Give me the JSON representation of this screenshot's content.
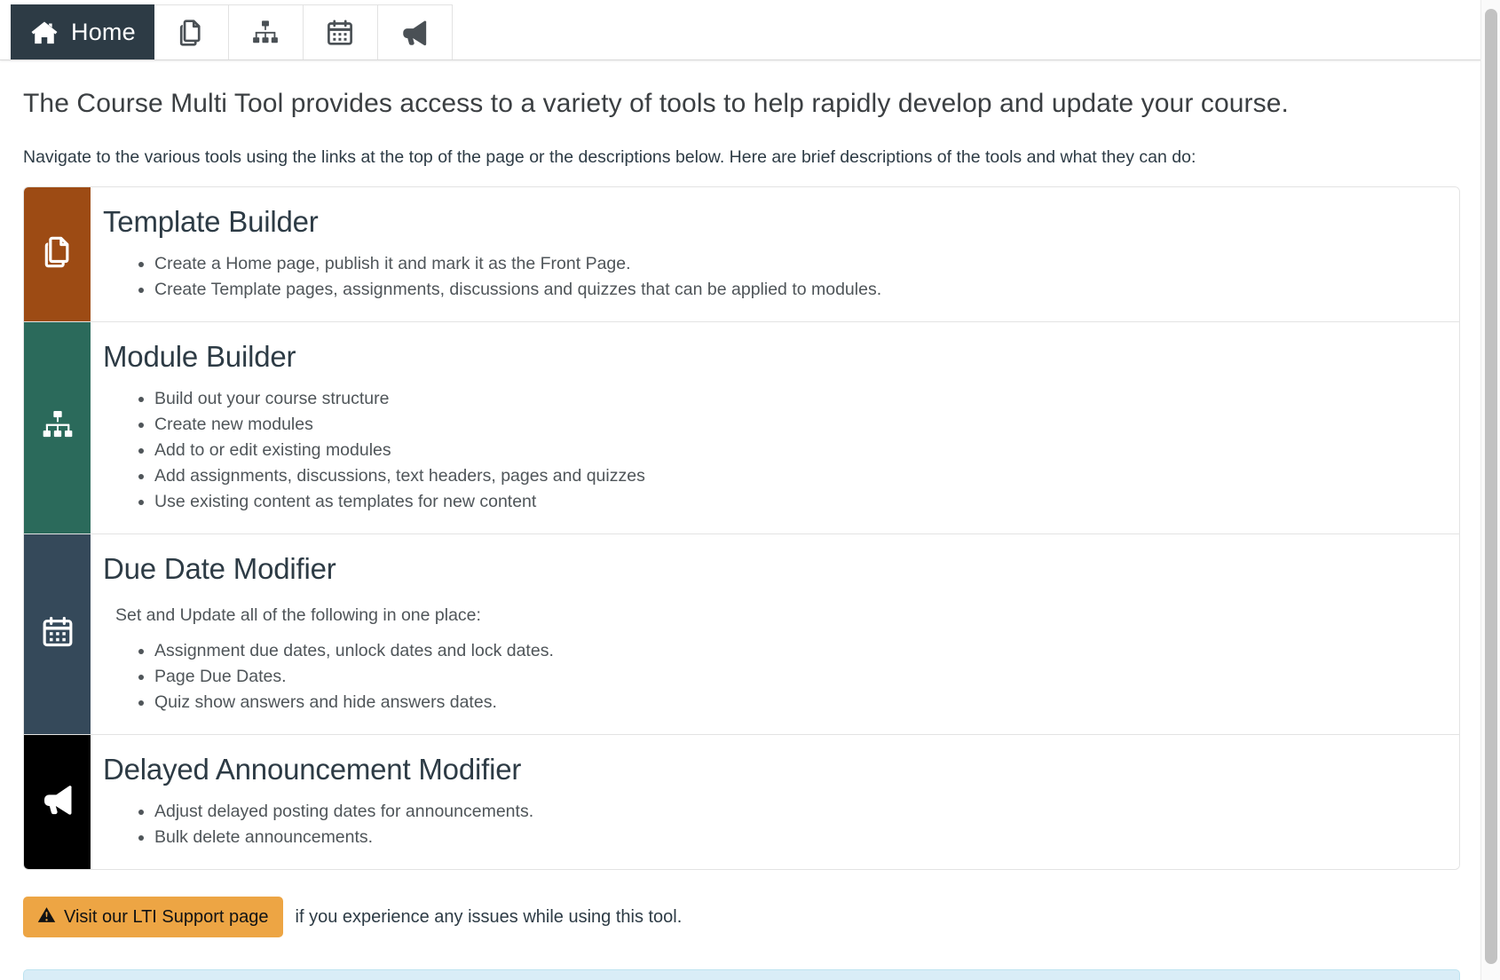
{
  "nav": {
    "tabs": [
      {
        "label": "Home",
        "icon": "home-icon",
        "active": true
      },
      {
        "label": "",
        "icon": "copy-pages-icon",
        "active": false
      },
      {
        "label": "",
        "icon": "sitemap-icon",
        "active": false
      },
      {
        "label": "",
        "icon": "calendar-icon",
        "active": false
      },
      {
        "label": "",
        "icon": "megaphone-icon",
        "active": false
      }
    ]
  },
  "page": {
    "lead": "The Course Multi Tool provides access to a variety of tools to help rapidly develop and update your course.",
    "intro": "Navigate to the various tools using the links at the top of the page or the descriptions below. Here are brief descriptions of the tools and what they can do:"
  },
  "cards": [
    {
      "title": "Template Builder",
      "icon": "copy-pages-icon",
      "color": "#9d4b14",
      "subtitle": "",
      "bullets": [
        "Create a Home page, publish it and mark it as the Front Page.",
        "Create Template pages, assignments, discussions and quizzes that can be applied to modules."
      ]
    },
    {
      "title": "Module Builder",
      "icon": "sitemap-icon",
      "color": "#2b6a5b",
      "subtitle": "",
      "bullets": [
        "Build out your course structure",
        "Create new modules",
        "Add to or edit existing modules",
        "Add assignments, discussions, text headers, pages and quizzes",
        "Use existing content as templates for new content"
      ]
    },
    {
      "title": "Due Date Modifier",
      "icon": "calendar-icon",
      "color": "#35495a",
      "subtitle": "Set and Update all of the following in one place:",
      "bullets": [
        "Assignment due dates, unlock dates and lock dates.",
        "Page Due Dates.",
        "Quiz show answers and hide answers dates."
      ]
    },
    {
      "title": "Delayed Announcement Modifier",
      "icon": "megaphone-icon",
      "color": "#000000",
      "subtitle": "",
      "bullets": [
        "Adjust delayed posting dates for announcements.",
        "Bulk delete announcements."
      ]
    }
  ],
  "support": {
    "button_label": "Visit our LTI Support page",
    "button_icon": "warning-triangle-icon",
    "button_color": "#eda544",
    "note": "if you experience any issues while using this tool."
  }
}
